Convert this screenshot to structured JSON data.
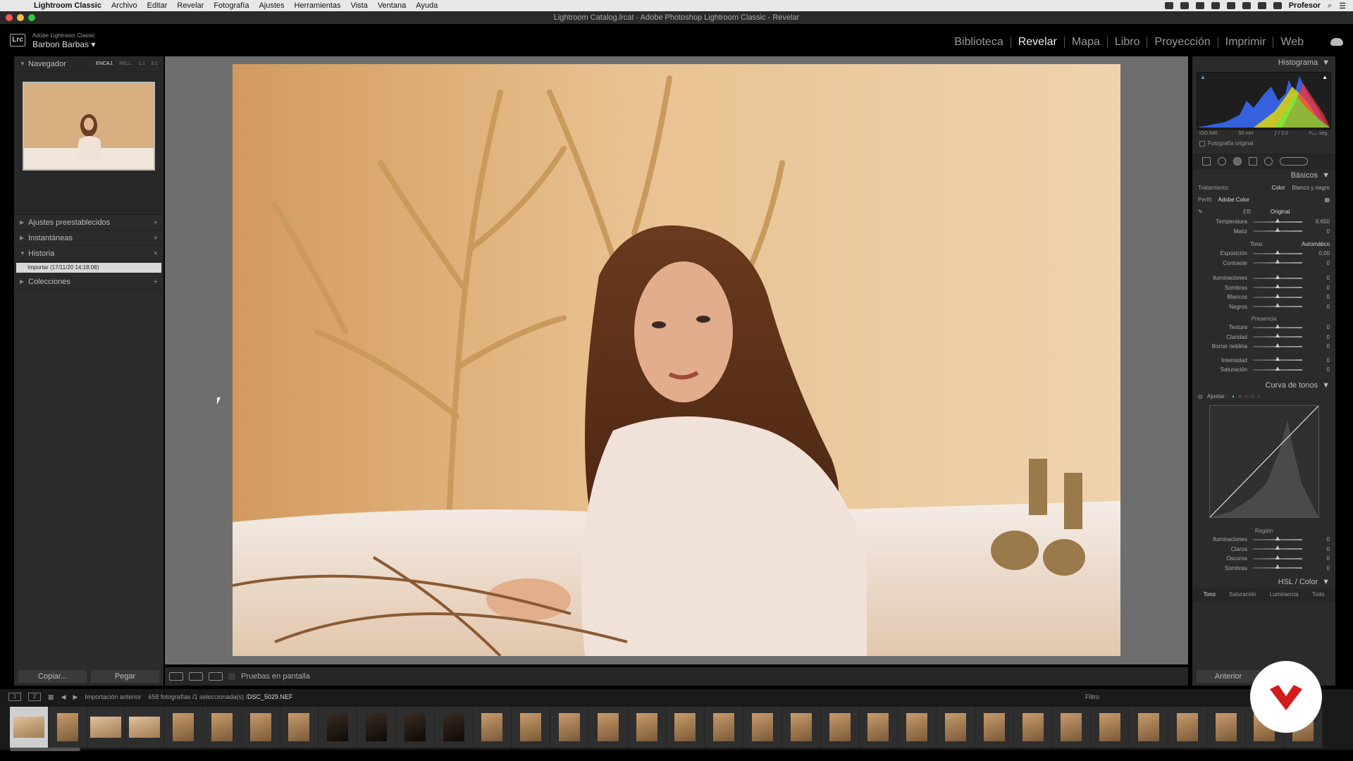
{
  "menubar": {
    "app_name": "Lightroom Classic",
    "items": [
      "Archivo",
      "Editar",
      "Revelar",
      "Fotografía",
      "Ajustes",
      "Herramientas",
      "Vista",
      "Ventana",
      "Ayuda"
    ],
    "user": "Profesor"
  },
  "window": {
    "title": "Lightroom Catalog.lrcat - Adobe Photoshop Lightroom Classic - Revelar"
  },
  "identity": {
    "product": "Adobe Lightroom Classic",
    "user": "Barbon Barbas",
    "logo": "Lrc"
  },
  "modules": [
    "Biblioteca",
    "Revelar",
    "Mapa",
    "Libro",
    "Proyección",
    "Imprimir",
    "Web"
  ],
  "active_module": "Revelar",
  "left_panel": {
    "navigator": {
      "title": "Navegador",
      "options": [
        "ENCAJ.",
        "RELL.",
        "1:1",
        "3:1"
      ]
    },
    "sections": [
      "Ajustes preestablecidos",
      "Instantáneas",
      "Historia",
      "Colecciones"
    ],
    "history_entry": "Importar (17/11/20 14:18:08)",
    "copy_button": "Copiar...",
    "paste_button": "Pegar"
  },
  "toolbar": {
    "soft_proof_label": "Pruebas en pantalla"
  },
  "right_panel": {
    "histogram_title": "Histograma",
    "exif": {
      "iso": "ISO 640",
      "focal": "50 mm",
      "aperture": "ƒ / 2,0",
      "shutter": "¹⁄₄₀₀ seg."
    },
    "original_photo": "Fotografía original",
    "basics_title": "Básicos",
    "treatment_label": "Tratamiento:",
    "treatment_color": "Color",
    "treatment_bw": "Blanco y negro",
    "profile_label": "Perfil:",
    "profile_value": "Adobe Color",
    "wb_label": "EB:",
    "wb_value": "Original",
    "tone_label": "Tono",
    "auto_label": "Automático",
    "presence_label": "Presencia",
    "sliders": [
      {
        "label": "Temperatura",
        "value": "6.650",
        "pos": 0.5
      },
      {
        "label": "Matiz",
        "value": "0",
        "pos": 0.5
      },
      {
        "label": "Exposición",
        "value": "0,00",
        "pos": 0.5
      },
      {
        "label": "Contraste",
        "value": "0",
        "pos": 0.5
      },
      {
        "label": "Iluminaciones",
        "value": "0",
        "pos": 0.5
      },
      {
        "label": "Sombras",
        "value": "0",
        "pos": 0.5
      },
      {
        "label": "Blancos",
        "value": "0",
        "pos": 0.5
      },
      {
        "label": "Negros",
        "value": "0",
        "pos": 0.5
      },
      {
        "label": "Textura",
        "value": "0",
        "pos": 0.5
      },
      {
        "label": "Claridad",
        "value": "0",
        "pos": 0.5
      },
      {
        "label": "Borrar neblina",
        "value": "0",
        "pos": 0.5
      },
      {
        "label": "Intensidad",
        "value": "0",
        "pos": 0.5
      },
      {
        "label": "Saturación",
        "value": "0",
        "pos": 0.5
      }
    ],
    "tone_curve_title": "Curva de tonos",
    "adjust_label": "Ajustar :",
    "region_label": "Región",
    "region_sliders": [
      {
        "label": "Iluminaciones",
        "value": "0"
      },
      {
        "label": "Claros",
        "value": "0"
      },
      {
        "label": "Oscuros",
        "value": "0"
      },
      {
        "label": "Sombras",
        "value": "0"
      }
    ],
    "hsl_title": "HSL / Color",
    "hsl_tabs": [
      "Tono",
      "Saturación",
      "Luminancia",
      "Todo"
    ],
    "previous_button": "Anterior"
  },
  "filmstrip": {
    "pages": [
      "1",
      "2"
    ],
    "source": "Importación anterior",
    "count": "658 fotografías /1 seleccionada(s) /",
    "filename": "DSC_5029.NEF",
    "filter_label": "Filtro",
    "thumbs": 34
  }
}
